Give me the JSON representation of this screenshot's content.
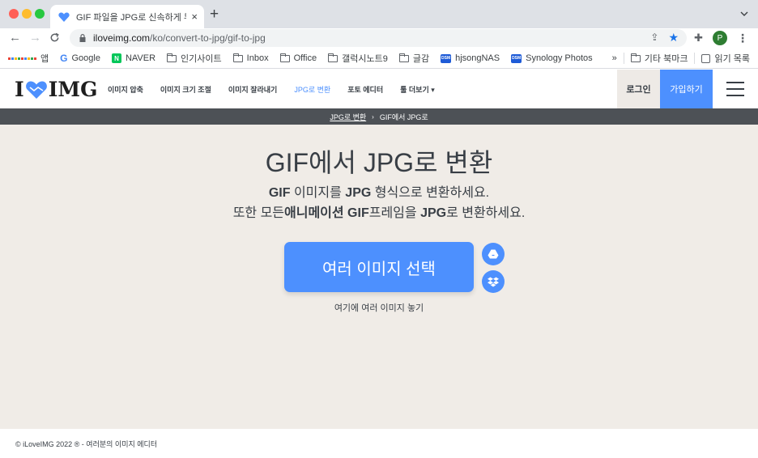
{
  "browser": {
    "tab_title": "GIF 파일을 JPG로 신속하게 무료 변",
    "tab_close": "×",
    "new_tab": "+",
    "url_domain": "iloveimg.com",
    "url_path": "/ko/convert-to-jpg/gif-to-jpg",
    "profile_initial": "P"
  },
  "bookmarks": {
    "items": [
      {
        "label": "앱",
        "icon": "apps-grid-icon"
      },
      {
        "label": "Google",
        "icon": "google-icon"
      },
      {
        "label": "NAVER",
        "icon": "naver-icon"
      },
      {
        "label": "인기사이트",
        "icon": "folder-icon"
      },
      {
        "label": "Inbox",
        "icon": "folder-icon"
      },
      {
        "label": "Office",
        "icon": "folder-icon"
      },
      {
        "label": "갤럭시노트9",
        "icon": "folder-icon"
      },
      {
        "label": "글감",
        "icon": "folder-icon"
      },
      {
        "label": "hjsongNAS",
        "icon": "dsm-icon"
      },
      {
        "label": "Synology Photos",
        "icon": "dsm-icon"
      }
    ],
    "overflow": "»",
    "other_bookmarks": "기타 북마크",
    "reading_list": "읽기 목록"
  },
  "site": {
    "logo_left": "I",
    "logo_right": "IMG",
    "nav": [
      {
        "label": "이미지 압축",
        "active": false
      },
      {
        "label": "이미지 크기 조절",
        "active": false
      },
      {
        "label": "이미지 잘라내기",
        "active": false
      },
      {
        "label": "JPG로 변환",
        "active": true
      },
      {
        "label": "포토 에디터",
        "active": false
      },
      {
        "label": "툴 더보기 ▾",
        "active": false
      }
    ],
    "login": "로그인",
    "signup": "가입하기"
  },
  "breadcrumb": {
    "parent": "JPG로 변환",
    "separator": "›",
    "current": "GIF에서 JPG로"
  },
  "main": {
    "title": "GIF에서 JPG로 변환",
    "sub1_b1": "GIF",
    "sub1_t1": " 이미지를 ",
    "sub1_b2": "JPG",
    "sub1_t2": " 형식으로 변환하세요.",
    "sub2_t1": "또한 모든",
    "sub2_b1": "애니메이션 GIF",
    "sub2_t2": "프레임을 ",
    "sub2_b2": "JPG",
    "sub2_t3": "로 변환하세요.",
    "select_button": "여러 이미지 선택",
    "drop_hint": "여기에 여러 이미지 놓기"
  },
  "footer": {
    "text": "© iLoveIMG 2022 ® - 여러분의 이미지 에디터"
  },
  "colors": {
    "brand_blue": "#4d90fe",
    "main_bg": "#f0ece7",
    "breadcrumb_bg": "#4d5156",
    "text_dark": "#383e45"
  }
}
